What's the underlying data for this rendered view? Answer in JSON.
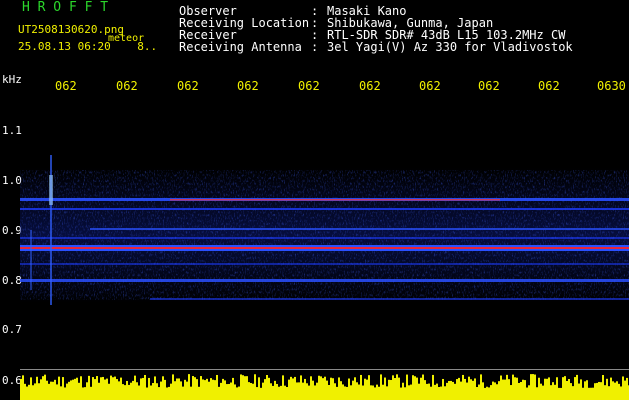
{
  "header": {
    "app_name": "H R O F F T",
    "file_name": "UT2508130620.png",
    "tag": "meteor",
    "datetime": "25.08.13 06:20",
    "extra": "8.."
  },
  "info": [
    {
      "label": "Observer",
      "value": "Masaki Kano"
    },
    {
      "label": "Receiving Location",
      "value": "Shibukawa, Gunma, Japan"
    },
    {
      "label": "Receiver",
      "value": "RTL-SDR SDR# 43dB L15 103.2MHz CW"
    },
    {
      "label": "Receiving Antenna",
      "value": "3el Yagi(V) Az 330 for Vladivostok"
    }
  ],
  "colon": ":",
  "axis": {
    "unit": "kHz",
    "y_ticks": [
      "1.1",
      "1.0",
      "0.9",
      "0.8",
      "0.7",
      "0.6"
    ],
    "time_ticks": [
      "062",
      "062",
      "062",
      "062",
      "062",
      "062",
      "062",
      "062",
      "062",
      "0630"
    ]
  },
  "colors": {
    "yellow": "#f0f000",
    "white": "#ffffff",
    "green": "#2bd62b",
    "signal_blue": "#1e3cff",
    "signal_red": "#ff2020"
  }
}
